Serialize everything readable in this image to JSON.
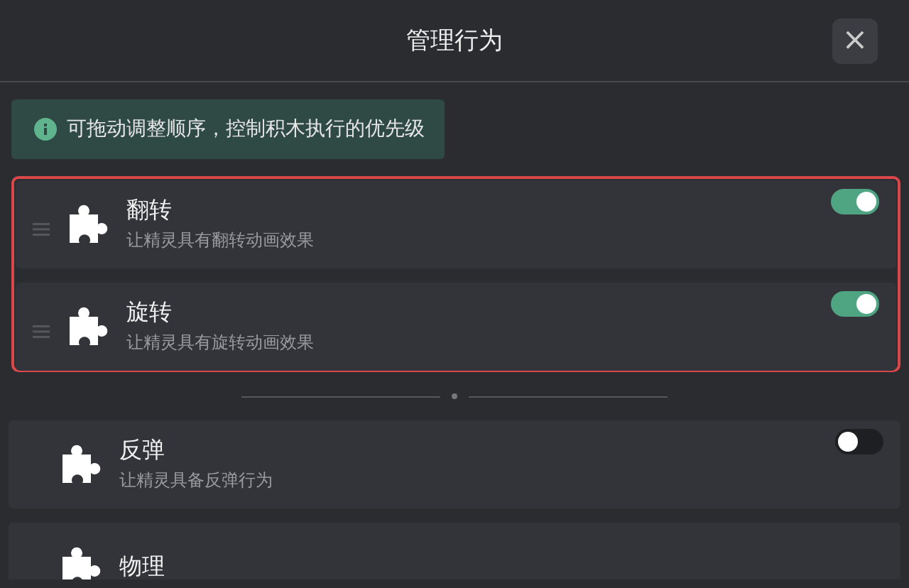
{
  "dialog": {
    "title": "管理行为",
    "close_label": "×"
  },
  "notice": {
    "text": "可拖动调整顺序，控制积木执行的优先级"
  },
  "ordered_behaviors": [
    {
      "title": "翻转",
      "description": "让精灵具有翻转动画效果",
      "on": true
    },
    {
      "title": "旋转",
      "description": "让精灵具有旋转动画效果",
      "on": true
    }
  ],
  "other_behaviors": [
    {
      "title": "反弹",
      "description": "让精灵具备反弹行为",
      "on": false
    },
    {
      "title": "物理"
    }
  ]
}
